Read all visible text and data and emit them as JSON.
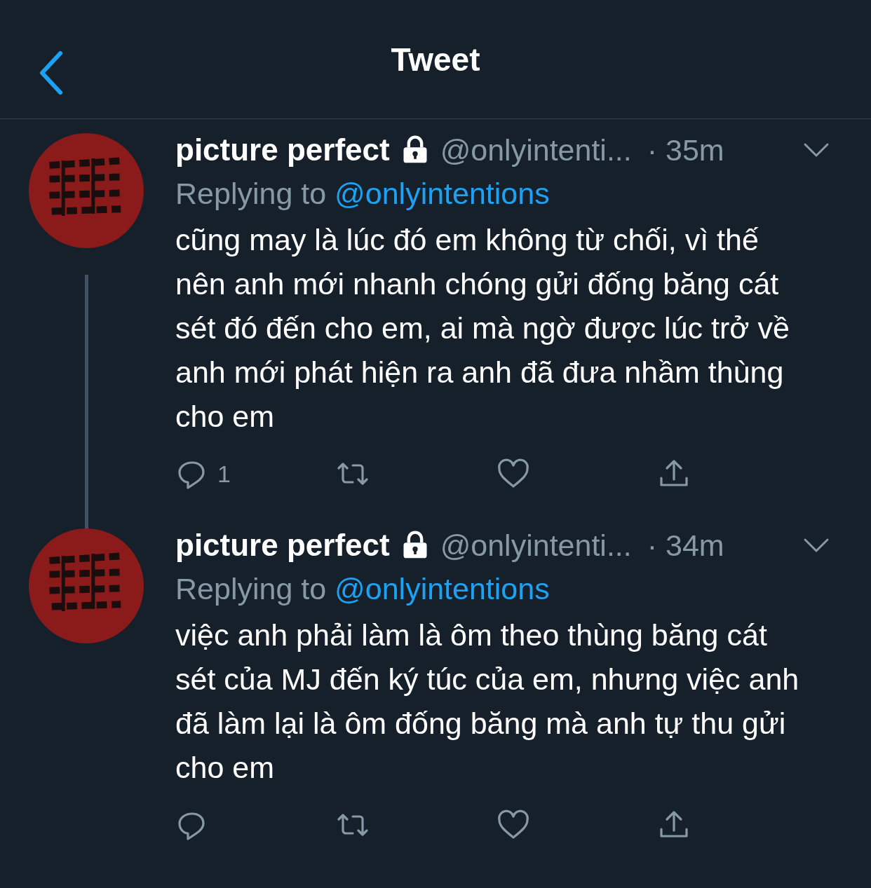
{
  "header": {
    "title": "Tweet"
  },
  "tweets": [
    {
      "name": "picture perfect",
      "protected": true,
      "handle": "@onlyintenti...",
      "time": "· 35m",
      "replying_label": "Replying to",
      "replying_to": "@onlyintentions",
      "text": "cũng may là lúc đó em không từ chối, vì thế nên anh mới nhanh chóng gửi đống băng cát sét đó đến cho em, ai mà ngờ được lúc trở về anh mới phát hiện ra anh đã đưa nhầm thùng cho em",
      "reply_count": "1",
      "thread_continues": true
    },
    {
      "name": "picture perfect",
      "protected": true,
      "handle": "@onlyintenti...",
      "time": "· 34m",
      "replying_label": "Replying to",
      "replying_to": "@onlyintentions",
      "text": "việc anh phải làm là ôm theo thùng băng cát sét của MJ đến ký túc của em, nhưng việc anh đã làm lại là ôm đống băng mà anh tự thu gửi cho em",
      "thread_continues": false
    }
  ]
}
